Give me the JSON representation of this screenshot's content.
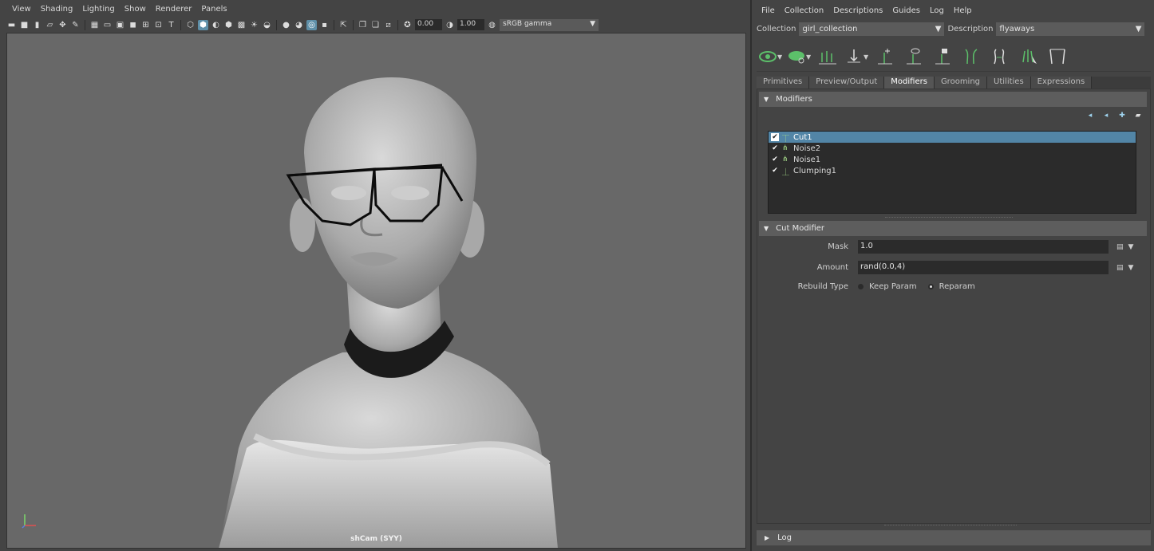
{
  "viewport": {
    "menu": [
      "View",
      "Shading",
      "Lighting",
      "Show",
      "Renderer",
      "Panels"
    ],
    "exposure": "0.00",
    "gamma": "1.00",
    "color_space": "sRGB gamma",
    "camera_label": "shCam (SYY)"
  },
  "xgen": {
    "menu": [
      "File",
      "Collection",
      "Descriptions",
      "Guides",
      "Log",
      "Help"
    ],
    "collection_label": "Collection",
    "collection_value": "girl_collection",
    "description_label": "Description",
    "description_value": "flyaways",
    "tabs": [
      "Primitives",
      "Preview/Output",
      "Modifiers",
      "Grooming",
      "Utilities",
      "Expressions"
    ],
    "active_tab": "Modifiers",
    "modifiers_section": "Modifiers",
    "modifiers": [
      {
        "name": "Cut1",
        "checked": true,
        "selected": true
      },
      {
        "name": "Noise2",
        "checked": true,
        "selected": false
      },
      {
        "name": "Noise1",
        "checked": true,
        "selected": false
      },
      {
        "name": "Clumping1",
        "checked": true,
        "selected": false
      }
    ],
    "cut_section": "Cut Modifier",
    "mask_label": "Mask",
    "mask_value": "1.0",
    "amount_label": "Amount",
    "amount_value": "rand(0.0,4)",
    "rebuild_label": "Rebuild Type",
    "rebuild_options": [
      "Keep Param",
      "Reparam"
    ],
    "rebuild_selected": "Reparam",
    "log_label": "Log"
  },
  "colors": {
    "selection": "#5285a6",
    "viewport_bg": "#686868",
    "icon_green": "#5cc06a",
    "panel_bg": "#444444"
  }
}
